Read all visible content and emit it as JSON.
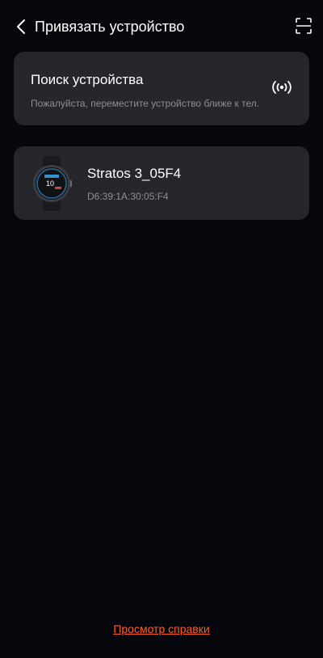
{
  "header": {
    "title": "Привязать устройство",
    "back_icon": "chevron-left-icon",
    "scan_icon": "scan-frame-icon"
  },
  "search": {
    "title": "Поиск устройства",
    "hint": "Пожалуйста, переместите устройство ближе к тел.",
    "status_icon": "broadcast-signal-icon"
  },
  "device": {
    "name": "Stratos 3_05F4",
    "mac": "D6:39:1A:30:05:F4",
    "image_icon": "smartwatch-icon",
    "watch_face_time": "10"
  },
  "footer": {
    "help_link": "Просмотр справки"
  },
  "colors": {
    "background": "#05070c",
    "card": "#26262d",
    "secondary_text": "#8e8e96",
    "link": "#ff5a2c"
  }
}
